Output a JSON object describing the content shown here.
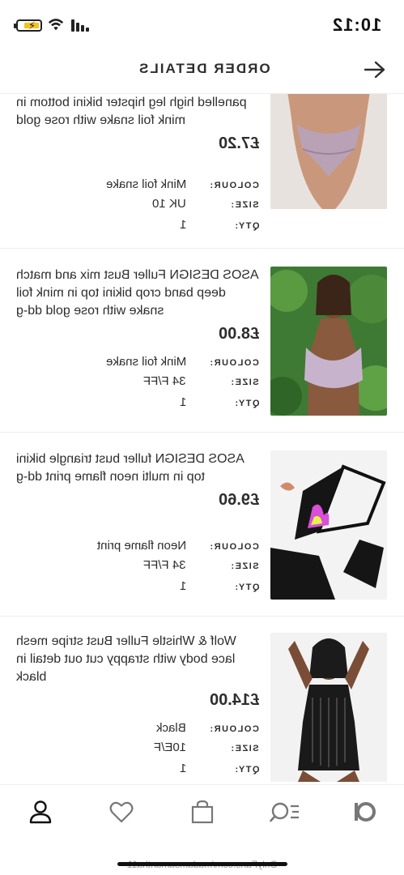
{
  "status_bar": {
    "time": "10:12"
  },
  "header": {
    "title": "ORDER DETAILS"
  },
  "items": [
    {
      "name": "panelled high leg hipster bikini bottom in mink foil snake with rose gold",
      "price": "£7.20",
      "colour_label": "COLOUR:",
      "colour": "Mink foil snake",
      "size_label": "SIZE:",
      "size": "UK 10",
      "qty_label": "QTY:",
      "qty": "1"
    },
    {
      "name": "ASOS DESIGN Fuller Bust mix and match deep band crop bikini top in mink foil snake with rose gold dd-g",
      "price": "£8.00",
      "colour_label": "COLOUR:",
      "colour": "Mink foil snake",
      "size_label": "SIZE:",
      "size": "34 F/FF",
      "qty_label": "QTY:",
      "qty": "1"
    },
    {
      "name": "ASOS DESIGN fuller bust triangle bikini top in multi neon flame print dd-g",
      "price": "£9.60",
      "colour_label": "COLOUR:",
      "colour": "Neon flame print",
      "size_label": "SIZE:",
      "size": "34 F/FF",
      "qty_label": "QTY:",
      "qty": "1"
    },
    {
      "name": "Wolf & Whistle Fuller Bust stripe mesh lace body with strappy cut out detail in black",
      "price": "£14.00",
      "colour_label": "COLOUR:",
      "colour": "Black",
      "size_label": "SIZE:",
      "size": "10E/F",
      "qty_label": "QTY:",
      "qty": "1"
    }
  ],
  "bottom_nav": {
    "icons": [
      "account-icon",
      "saved-icon",
      "bag-icon",
      "search-icon",
      "home-logo-icon"
    ]
  },
  "watermark": "OnlyFans.com/madamsamantha11",
  "colors": {
    "text": "#2d2d2d",
    "divider": "#eeeeee",
    "battery": "#f3c21b"
  }
}
